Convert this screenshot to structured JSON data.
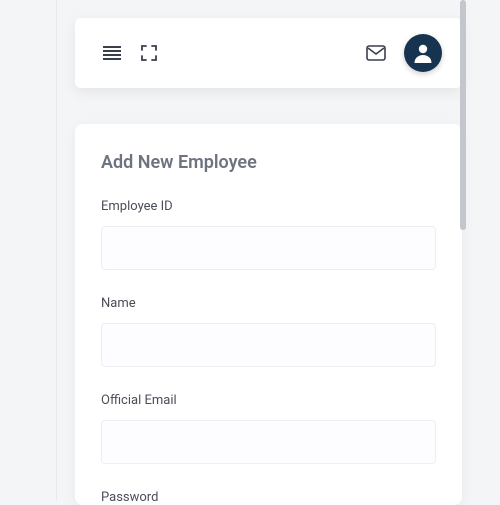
{
  "header": {
    "icons": {
      "menu": "menu-icon",
      "fullscreen": "fullscreen-icon",
      "mail": "mail-icon",
      "avatar": "avatar-icon"
    }
  },
  "form": {
    "title": "Add New Employee",
    "fields": {
      "employee_id": {
        "label": "Employee ID",
        "value": ""
      },
      "name": {
        "label": "Name",
        "value": ""
      },
      "email": {
        "label": "Official Email",
        "value": ""
      },
      "password": {
        "label": "Password",
        "value": ""
      }
    }
  }
}
